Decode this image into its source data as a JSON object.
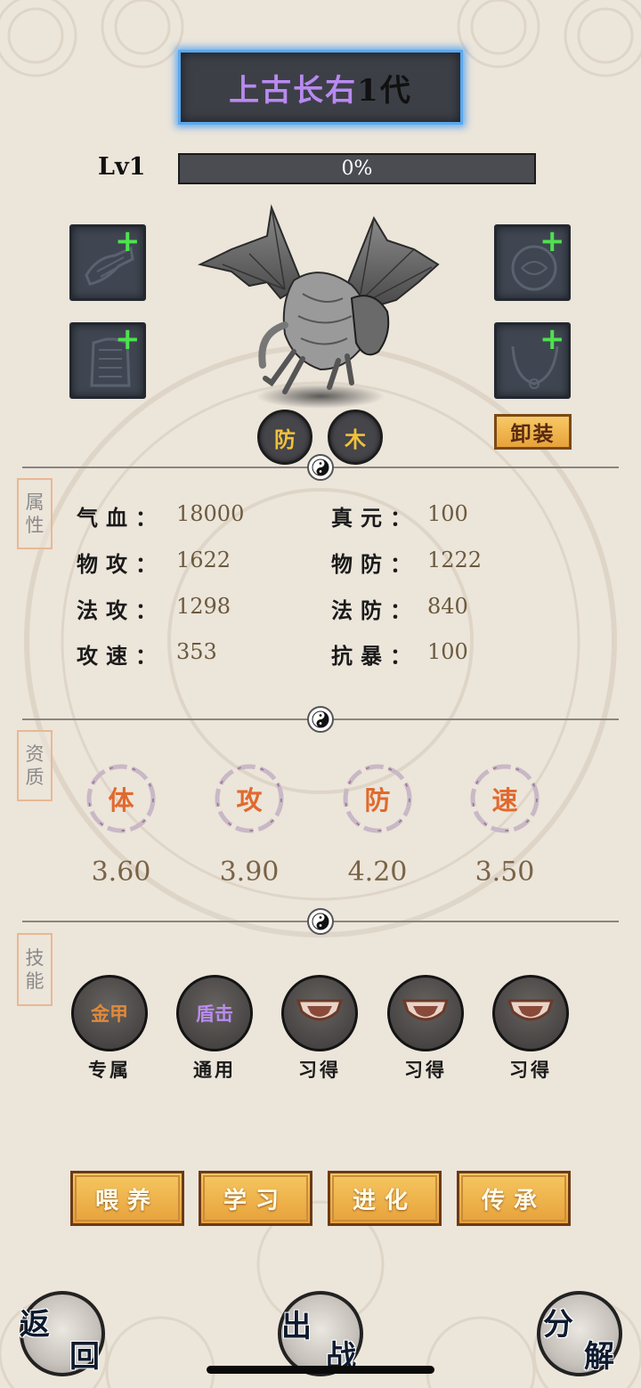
{
  "header": {
    "pet_name": "上古长右",
    "generation": "1代"
  },
  "level": {
    "label": "Lv1",
    "exp_text": "0%",
    "exp_progress": 0
  },
  "pet": {
    "type_badges": [
      "防",
      "木"
    ],
    "unequip_label": "卸装",
    "equip_slots": [
      {
        "icon": "glove-icon",
        "add": "+"
      },
      {
        "icon": "armor-icon",
        "add": "+"
      },
      {
        "icon": "orb-icon",
        "add": "+"
      },
      {
        "icon": "necklace-icon",
        "add": "+"
      }
    ]
  },
  "attributes": {
    "section_label": [
      "属",
      "性"
    ],
    "items": [
      {
        "key": "气血：",
        "value": "18000"
      },
      {
        "key": "真元：",
        "value": "100"
      },
      {
        "key": "物攻：",
        "value": "1622"
      },
      {
        "key": "物防：",
        "value": "1222"
      },
      {
        "key": "法攻：",
        "value": "1298"
      },
      {
        "key": "法防：",
        "value": "840"
      },
      {
        "key": "攻速：",
        "value": "353"
      },
      {
        "key": "抗暴：",
        "value": "100"
      }
    ]
  },
  "aptitude": {
    "section_label": [
      "资",
      "质"
    ],
    "items": [
      {
        "char": "体",
        "value": "3.60"
      },
      {
        "char": "攻",
        "value": "3.90"
      },
      {
        "char": "防",
        "value": "4.20"
      },
      {
        "char": "速",
        "value": "3.50"
      }
    ]
  },
  "skills": {
    "section_label": [
      "技",
      "能"
    ],
    "items": [
      {
        "name": "金甲",
        "name_color": "#e08a3a",
        "label": "专属"
      },
      {
        "name": "盾击",
        "name_color": "#b98cf0",
        "label": "通用"
      },
      {
        "name": "",
        "label": "习得"
      },
      {
        "name": "",
        "label": "习得"
      },
      {
        "name": "",
        "label": "习得"
      }
    ]
  },
  "actions": [
    "喂养",
    "学习",
    "进化",
    "传承"
  ],
  "nav": {
    "back": [
      "返",
      "回"
    ],
    "fight": [
      "出",
      "战"
    ],
    "decompose": [
      "分",
      "解"
    ]
  },
  "colors": {
    "background": "#ece5da",
    "title_border": "#5aa8ee",
    "title_name": "#b88af0",
    "badge_text": "#f0c13a",
    "aptitude_char": "#e06a2e",
    "add_plus": "#4ee24e",
    "button_gold": "#f0b24c"
  }
}
